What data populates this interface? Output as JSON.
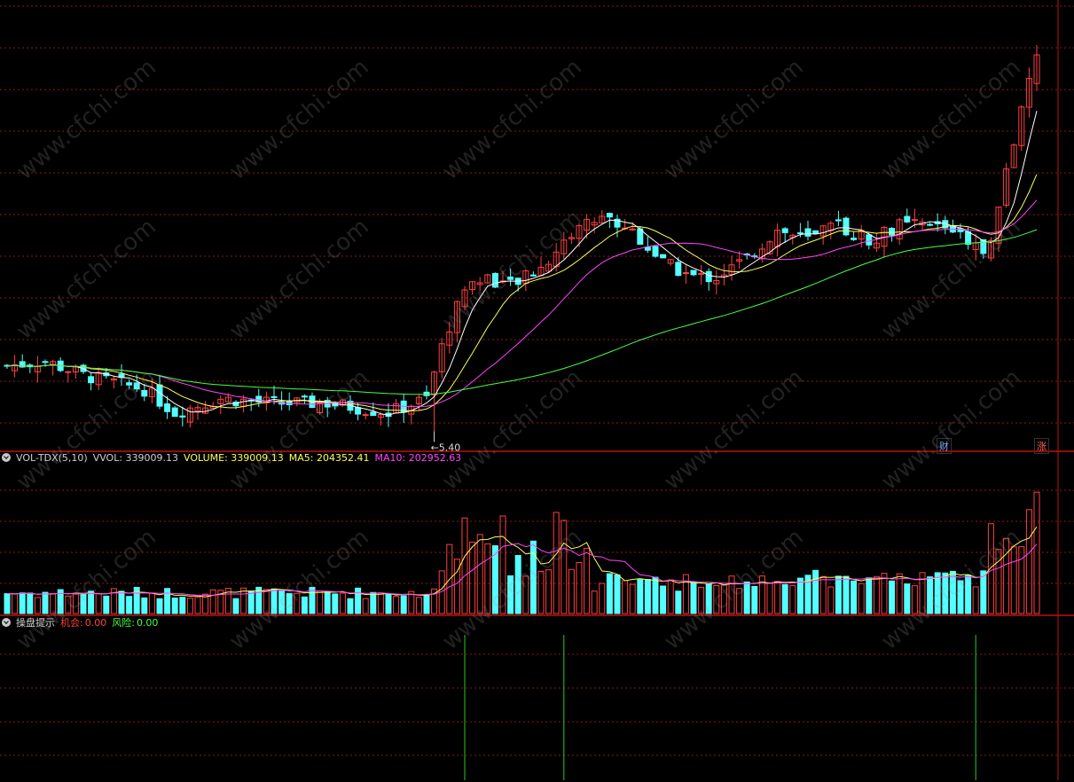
{
  "watermark": "www.cfchi.com",
  "price_panel": {
    "low_marker": "5.40",
    "badge_left": "财",
    "badge_right": "涨"
  },
  "volume_panel": {
    "name": "VOL-TDX(5,10)",
    "vvol": "VVOL: 339009.13",
    "volume": "VOLUME: 339009.13",
    "ma5": "MA5: 204352.41",
    "ma10": "MA10: 202952.63"
  },
  "signal_panel": {
    "name": "操盘提示",
    "opportunity_label": "机会:",
    "opportunity_value": "0.00",
    "risk_label": "风险:",
    "risk_value": "0.00"
  },
  "colors": {
    "up": "#ff4040",
    "down": "#54ffff",
    "ma5": "#ffffff",
    "ma10": "#ffff55",
    "ma20": "#ff44ff",
    "ma60": "#44ff44",
    "grid": "#8c1a1a",
    "divider": "#c01010",
    "signal": "#22cc22"
  },
  "chart_data": {
    "type": "candlestick",
    "n_bars": 136,
    "price_range": [
      5.3,
      9.9
    ],
    "price_low_point": 5.4,
    "volume_range": [
      0,
      600000
    ],
    "signal_bar_indices": [
      60,
      73,
      127
    ]
  }
}
